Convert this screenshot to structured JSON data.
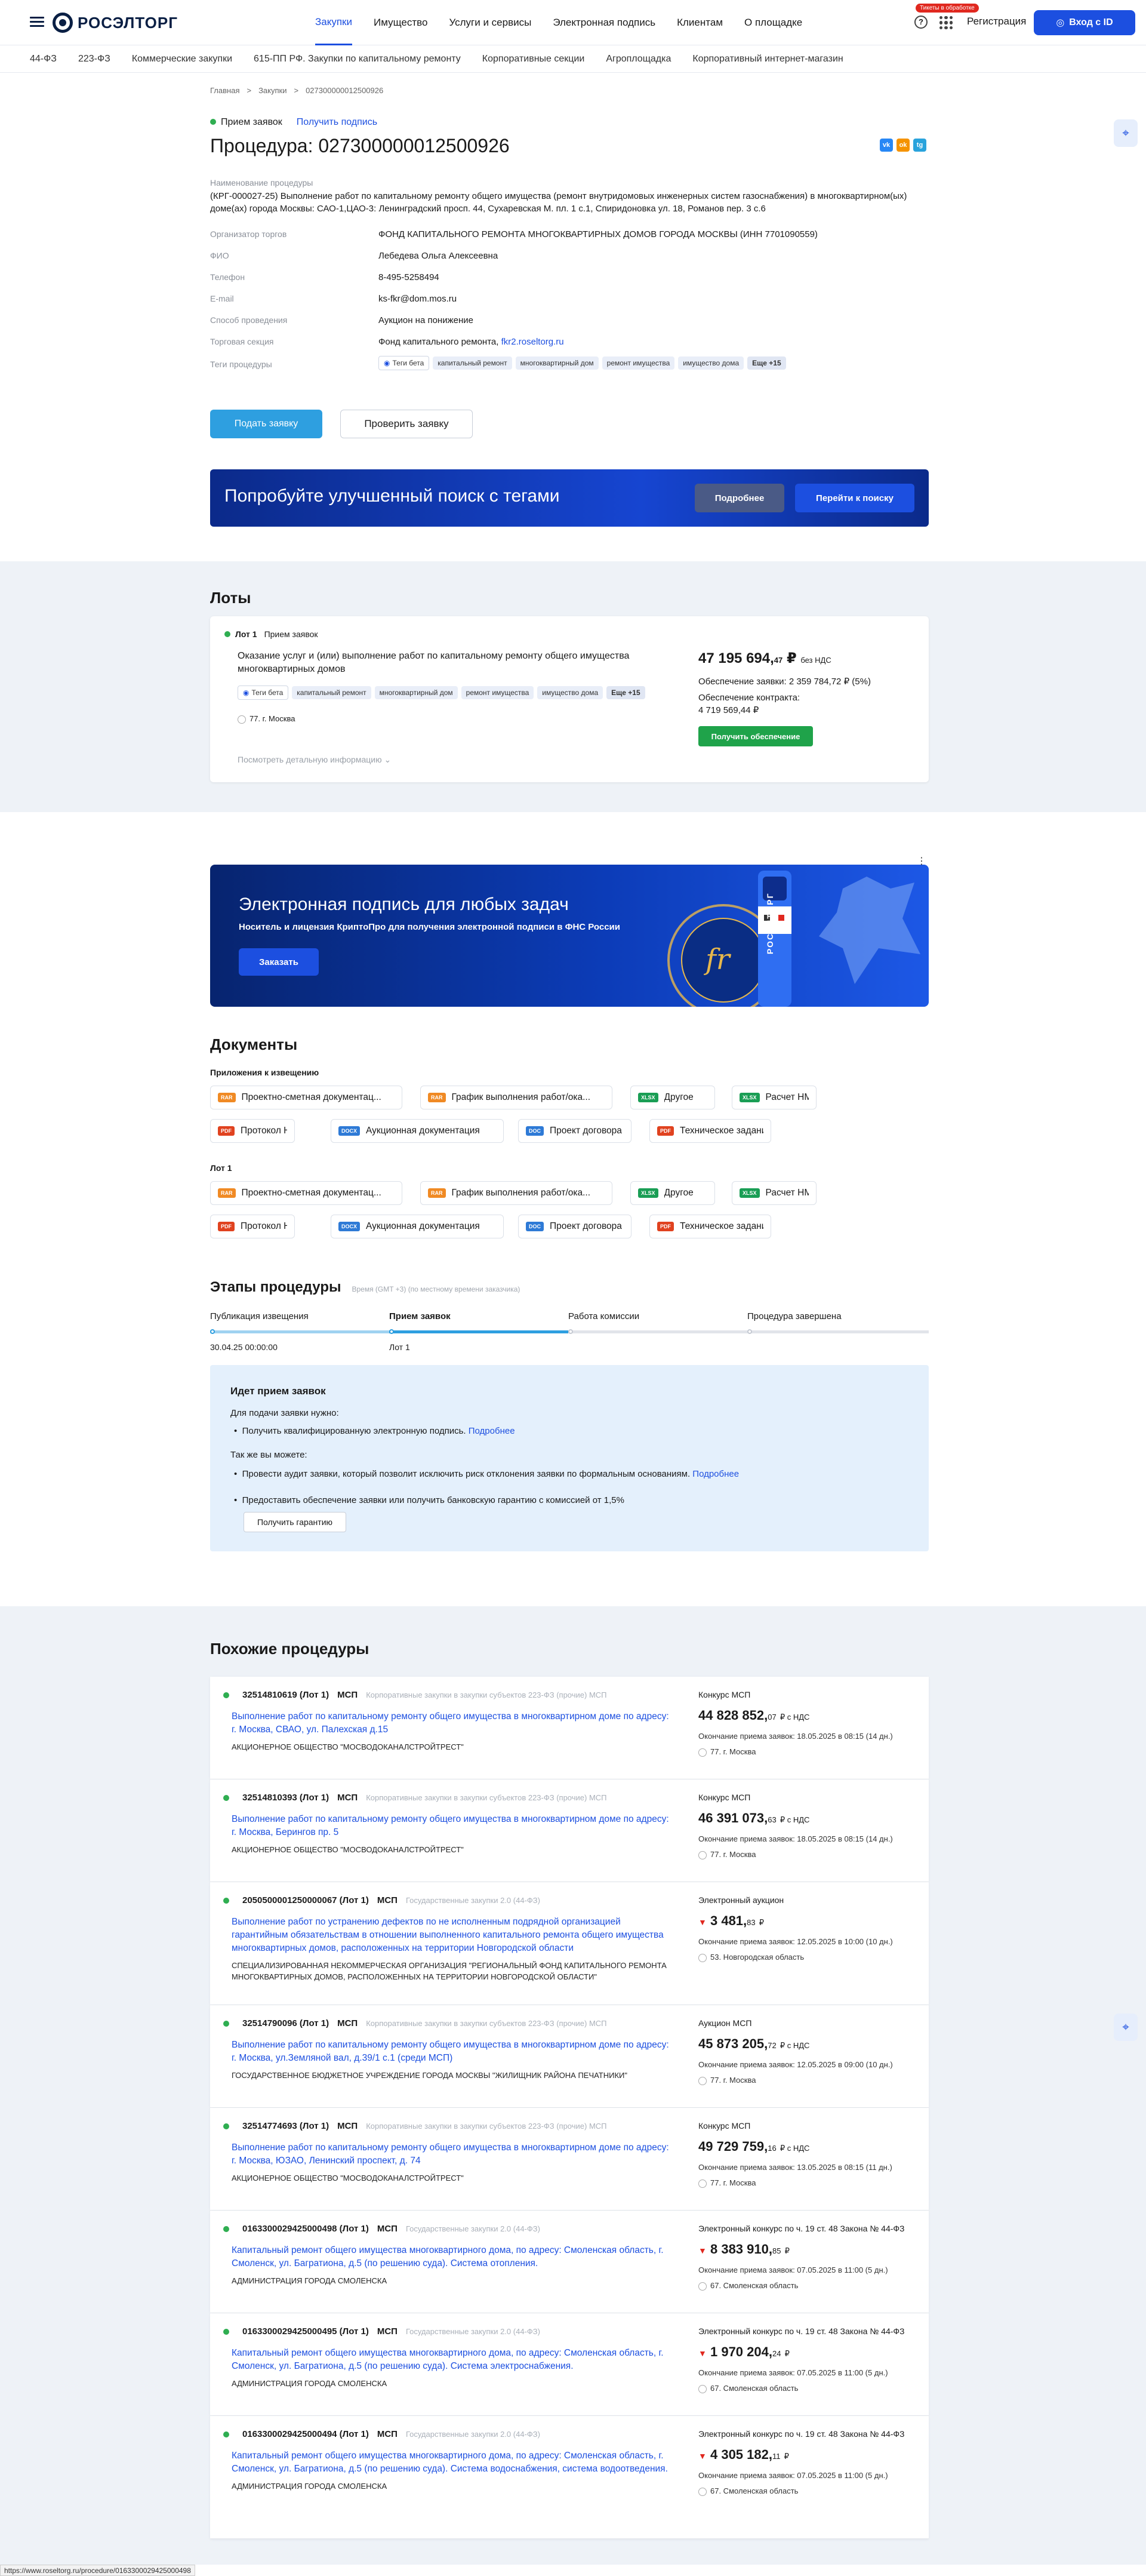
{
  "header": {
    "logo": "РОСЭЛТОРГ",
    "nav": [
      "Закупки",
      "Имущество",
      "Услуги и сервисы",
      "Электронная подпись",
      "Клиентам",
      "О площадке"
    ],
    "badge": "Тикеты в обработке",
    "register": "Регистрация",
    "login": "Вход с ID",
    "accent": "#1c4fe0"
  },
  "subnav": [
    "44-ФЗ",
    "223-ФЗ",
    "Коммерческие закупки",
    "615-ПП РФ. Закупки по капитальному ремонту",
    "Корпоративные секции",
    "Агроплощадка",
    "Корпоративный интернет-магазин"
  ],
  "crumbs": [
    "Главная",
    ">",
    "Закупки",
    ">",
    "027300000012500926"
  ],
  "status": {
    "label": "Прием заявок",
    "link": "Получить подпись"
  },
  "title": "Процедура: 027300000012500926",
  "fields": {
    "name_label": "Наименование процедуры",
    "name_value": "(КРГ-000027-25) Выполнение работ по капитальному ремонту общего имущества (ремонт внутридомовых инженерных систем газоснабжения) в многоквартирном(ых) доме(ах) города Москвы: САО-1,ЦАО-3: Ленинградский просп. 44, Сухаревская М. пл. 1 с.1, Спиридоновка ул. 18, Романов пер. 3 с.6",
    "org_label": "Организатор торгов",
    "org_value": "ФОНД КАПИТАЛЬНОГО РЕМОНТА МНОГОКВАРТИРНЫХ ДОМОВ ГОРОДА МОСКВЫ (ИНН 7701090559)",
    "fio_label": "ФИО",
    "fio_value": "Лебедева Ольга Алексеевна",
    "phone_label": "Телефон",
    "phone_value": "8-495-5258494",
    "email_label": "E-mail",
    "email_value": "ks-fkr@dom.mos.ru",
    "method_label": "Способ проведения",
    "method_value": "Аукцион на понижение",
    "section_label": "Торговая секция",
    "section_value": "Фонд капитального ремонта,",
    "section_link": "fkr2.roseltorg.ru",
    "tags_label": "Теги процедуры"
  },
  "tags": {
    "beta": "Теги бета",
    "items": [
      "капитальный ремонт",
      "многоквартирный дом",
      "ремонт имущества",
      "имущество дома"
    ],
    "more": "Еще +15"
  },
  "actions": {
    "submit": "Подать заявку",
    "check": "Проверить заявку"
  },
  "promo": {
    "text": "Попробуйте улучшенный поиск с тегами",
    "more": "Подробнее",
    "go": "Перейти к поиску"
  },
  "lots": {
    "heading": "Лоты",
    "lot_no": "Лот 1",
    "lot_status": "Прием заявок",
    "name": "Оказание услуг и (или) выполнение работ по капитальному ремонту общего имущества многоквартирных домов",
    "region": "77. г. Москва",
    "details": "Посмотреть детальную информацию",
    "price_main": "47 195 694,",
    "price_kop": "47",
    "price_cur": "₽",
    "price_vat": "без НДС",
    "app_sec": "Обеспечение заявки: 2 359 784,72 ₽ (5%)",
    "contract_sec_label": "Обеспечение контракта:",
    "contract_sec_value": "4 719 569,44 ₽",
    "get_sec": "Получить обеспечение"
  },
  "esign": {
    "title": "Электронная подпись для любых задач",
    "sub": "Носитель и лицензия КриптоПро для получения электронной подписи в ФНС России",
    "btn": "Заказать",
    "token": "РОСЭЛТОРГ"
  },
  "docs": {
    "heading": "Документы",
    "group1": "Приложения к извещению",
    "group2": "Лот 1",
    "items": [
      {
        "type": "RAR",
        "name": "Проектно-сметная документац..."
      },
      {
        "type": "RAR",
        "name": "График выполнения работ/ока..."
      },
      {
        "type": "XLSX",
        "name": "Другое"
      },
      {
        "type": "XLSX",
        "name": "Расчет НМЦ"
      },
      {
        "type": "PDF",
        "name": "Протокол НМЦ"
      },
      {
        "type": "DOCX",
        "name": "Аукционная документация"
      },
      {
        "type": "DOC",
        "name": "Проект договора"
      },
      {
        "type": "PDF",
        "name": "Техническое задание"
      }
    ]
  },
  "stages": {
    "heading": "Этапы процедуры",
    "tz": "Время (GMT +3) (по местному времени заказчика)",
    "steps": [
      "Публикация извещения",
      "Прием заявок",
      "Работа комиссии",
      "Процедура завершена"
    ],
    "date": "30.04.25 00:00:00",
    "lot": "Лот 1"
  },
  "info": {
    "title": "Идет прием заявок",
    "p1": "Для подачи заявки нужно:",
    "b1": "Получить квалифицированную электронную подпись.",
    "more": "Подробнее",
    "p2": "Так же вы можете:",
    "b2": "Провести аудит заявки, который позволит исключить риск отклонения заявки по формальным основаниям.",
    "b3": "Предоставить обеспечение заявки или получить банковскую гарантию с комиссией от 1,5%",
    "btn": "Получить гарантию"
  },
  "similar": {
    "heading": "Похожие процедуры",
    "items": [
      {
        "id": "32514810619 (Лот 1)",
        "msp": "МСП",
        "cat": "Корпоративные закупки в закупки субъектов 223-ФЗ (прочие) МСП",
        "name": "Выполнение работ по капитальному ремонту общего имущества в многоквартирном доме по адресу: г. Москва, СВАО, ул. Палехская д.15",
        "org": "АКЦИОНЕРНОЕ ОБЩЕСТВО \"МОСВОДОКАНАЛСТРОЙТРЕСТ\"",
        "type": "Конкурс МСП",
        "price": "44 828 852,",
        "kop": "07",
        "vat": "₽ с НДС",
        "end": "Окончание приема заявок: 18.05.2025 в 08:15 (14 дн.)",
        "region": "77. г. Москва",
        "down": false
      },
      {
        "id": "32514810393 (Лот 1)",
        "msp": "МСП",
        "cat": "Корпоративные закупки в закупки субъектов 223-ФЗ (прочие) МСП",
        "name": "Выполнение работ по капитальному ремонту общего имущества в многоквартирном доме по адресу: г. Москва, Берингов пр. 5",
        "org": "АКЦИОНЕРНОЕ ОБЩЕСТВО \"МОСВОДОКАНАЛСТРОЙТРЕСТ\"",
        "type": "Конкурс МСП",
        "price": "46 391 073,",
        "kop": "63",
        "vat": "₽ с НДС",
        "end": "Окончание приема заявок: 18.05.2025 в 08:15 (14 дн.)",
        "region": "77. г. Москва",
        "down": false
      },
      {
        "id": "2050500001250000067 (Лот 1)",
        "msp": "МСП",
        "cat": "Государственные закупки 2.0 (44-ФЗ)",
        "name": "Выполнение работ по устранению дефектов по не исполненным подрядной организацией гарантийным обязательствам в отношении выполненного капитального ремонта общего имущества многоквартирных домов, расположенных на территории Новгородской области",
        "org": "СПЕЦИАЛИЗИРОВАННАЯ НЕКОММЕРЧЕСКАЯ ОРГАНИЗАЦИЯ \"РЕГИОНАЛЬНЫЙ ФОНД КАПИТАЛЬНОГО РЕМОНТА МНОГОКВАРТИРНЫХ ДОМОВ, РАСПОЛОЖЕННЫХ НА ТЕРРИТОРИИ НОВГОРОДСКОЙ ОБЛАСТИ\"",
        "type": "Электронный аукцион",
        "price": "3 481,",
        "kop": "83",
        "vat": "₽",
        "end": "Окончание приема заявок: 12.05.2025 в 10:00 (10 дн.)",
        "region": "53. Новгородская область",
        "down": true
      },
      {
        "id": "32514790096 (Лот 1)",
        "msp": "МСП",
        "cat": "Корпоративные закупки в закупки субъектов 223-ФЗ (прочие) МСП",
        "name": "Выполнение работ по капитальному ремонту общего имущества в многоквартирном доме по адресу: г. Москва, ул.Земляной вал, д.39/1 с.1 (среди МСП)",
        "org": "ГОСУДАРСТВЕННОЕ БЮДЖЕТНОЕ УЧРЕЖДЕНИЕ ГОРОДА МОСКВЫ \"ЖИЛИЩНИК РАЙОНА ПЕЧАТНИКИ\"",
        "type": "Аукцион МСП",
        "price": "45 873 205,",
        "kop": "72",
        "vat": "₽ с НДС",
        "end": "Окончание приема заявок: 12.05.2025 в 09:00 (10 дн.)",
        "region": "77. г. Москва",
        "down": false
      },
      {
        "id": "32514774693 (Лот 1)",
        "msp": "МСП",
        "cat": "Корпоративные закупки в закупки субъектов 223-ФЗ (прочие) МСП",
        "name": "Выполнение работ по капитальному ремонту общего имущества в многоквартирном доме по адресу: г. Москва, ЮЗАО, Ленинский проспект, д. 74",
        "org": "АКЦИОНЕРНОЕ ОБЩЕСТВО \"МОСВОДОКАНАЛСТРОЙТРЕСТ\"",
        "type": "Конкурс МСП",
        "price": "49 729 759,",
        "kop": "16",
        "vat": "₽ с НДС",
        "end": "Окончание приема заявок: 13.05.2025 в 08:15 (11 дн.)",
        "region": "77. г. Москва",
        "down": false
      },
      {
        "id": "0163300029425000498 (Лот 1)",
        "msp": "МСП",
        "cat": "Государственные закупки 2.0 (44-ФЗ)",
        "name": "Капитальный ремонт общего имущества многоквартирного дома, по адресу: Смоленская область, г. Смоленск, ул. Багратиона, д.5 (по решению суда). Система отопления.",
        "org": "АДМИНИСТРАЦИЯ ГОРОДА СМОЛЕНСКА",
        "type": "Электронный конкурс по ч. 19 ст. 48 Закона № 44-ФЗ",
        "price": "8 383 910,",
        "kop": "85",
        "vat": "₽",
        "end": "Окончание приема заявок: 07.05.2025 в 11:00 (5 дн.)",
        "region": "67. Смоленская область",
        "down": true
      },
      {
        "id": "0163300029425000495 (Лот 1)",
        "msp": "МСП",
        "cat": "Государственные закупки 2.0 (44-ФЗ)",
        "name": "Капитальный ремонт общего имущества многоквартирного дома, по адресу: Смоленская область, г. Смоленск, ул. Багратиона, д.5 (по решению суда). Система электроснабжения.",
        "org": "АДМИНИСТРАЦИЯ ГОРОДА СМОЛЕНСКА",
        "type": "Электронный конкурс по ч. 19 ст. 48 Закона № 44-ФЗ",
        "price": "1 970 204,",
        "kop": "24",
        "vat": "₽",
        "end": "Окончание приема заявок: 07.05.2025 в 11:00 (5 дн.)",
        "region": "67. Смоленская область",
        "down": true
      },
      {
        "id": "0163300029425000494 (Лот 1)",
        "msp": "МСП",
        "cat": "Государственные закупки 2.0 (44-ФЗ)",
        "name": "Капитальный ремонт общего имущества многоквартирного дома, по адресу: Смоленская область, г. Смоленск, ул. Багратиона, д.5 (по решению суда). Система водоснабжения, система водоотведения.",
        "org": "АДМИНИСТРАЦИЯ ГОРОДА СМОЛЕНСКА",
        "type": "Электронный конкурс по ч. 19 ст. 48 Закона № 44-ФЗ",
        "price": "4 305 182,",
        "kop": "11",
        "vat": "₽",
        "end": "Окончание приема заявок: 07.05.2025 в 11:00 (5 дн.)",
        "region": "67. Смоленская область",
        "down": true
      }
    ]
  },
  "statusbar": "https://www.roseltorg.ru/procedure/0163300029425000498"
}
